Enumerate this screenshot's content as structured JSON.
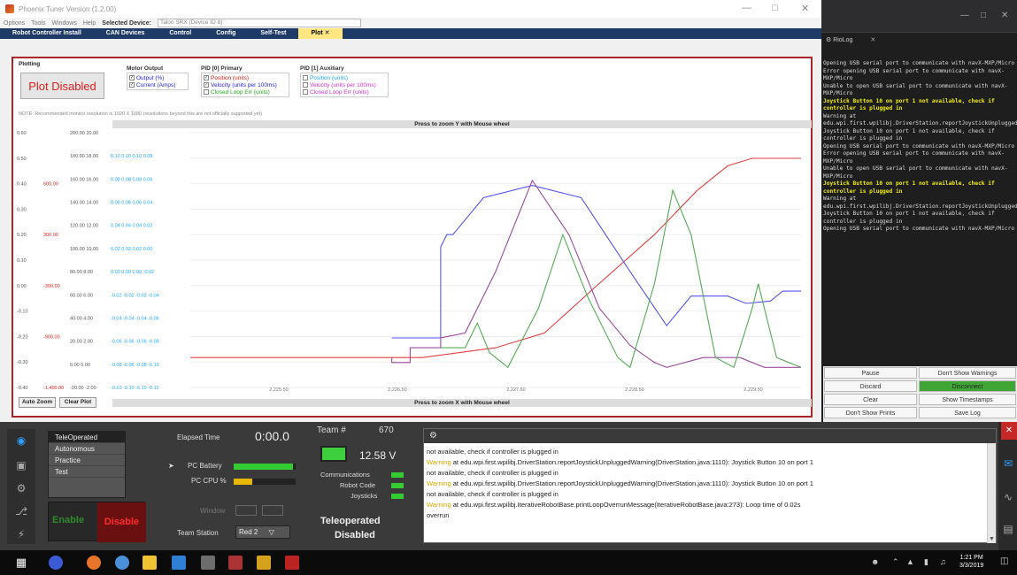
{
  "tuner": {
    "title": "Phoenix Tuner Version (1.2.00)",
    "menu": [
      "Options",
      "Tools",
      "Windows",
      "Help"
    ],
    "selected_device_label": "Selected Device:",
    "selected_device_value": "Talon SRX (Device ID 8)",
    "tabs": [
      "Robot Controller Install",
      "CAN Devices",
      "Control",
      "Config",
      "Self-Test",
      "Plot"
    ],
    "active_tab": "Plot",
    "plot": {
      "section_label": "Plotting",
      "plot_button": "Plot Disabled",
      "motor_output": {
        "title": "Motor Output",
        "items": [
          {
            "label": "Output (%)",
            "checked": true,
            "color": "#2222ee"
          },
          {
            "label": "Current (Amps)",
            "checked": true,
            "color": "#2222ee"
          }
        ]
      },
      "pid0": {
        "title": "PID [0] Primary",
        "items": [
          {
            "label": "Position (units)",
            "checked": true,
            "color": "#e02020"
          },
          {
            "label": "Velocity (units per 100ms)",
            "checked": true,
            "color": "#2222ee"
          },
          {
            "label": "Closed Loop Err (units)",
            "checked": false,
            "color": "#22aa22"
          }
        ]
      },
      "pid1": {
        "title": "PID [1] Auxiliary",
        "items": [
          {
            "label": "Position (units)",
            "checked": false,
            "color": "#22aaff"
          },
          {
            "label": "Velocity (units per 100ms)",
            "checked": false,
            "color": "#cc33cc"
          },
          {
            "label": "Closed Loop Err (units)",
            "checked": false,
            "color": "#cc33cc"
          }
        ]
      },
      "note": "NOTE: Recommended monitor resolution is 1920 X 1080 (resolutions beyond this are not officially supported yet)",
      "zoom_y": "Press to zoom Y with Mouse wheel",
      "zoom_x": "Press to zoom X with Mouse wheel",
      "auto_zoom": "Auto Zoom",
      "clear_plot": "Clear Plot"
    }
  },
  "chart_data": {
    "type": "line",
    "x_ticks": [
      "2,225.50",
      "2,226.50",
      "2,227.50",
      "2,228.50",
      "2,229.50"
    ],
    "y_axes": [
      {
        "color": "#555555",
        "labels": [
          "0.60",
          "0.50",
          "0.40",
          "0.30",
          "0.20",
          "0.10",
          "0.00",
          "-0.10",
          "-0.20",
          "-0.30",
          "-0.40"
        ]
      },
      {
        "color": "#e02020",
        "labels": [
          "",
          "",
          "600.00",
          "",
          "300.00",
          "",
          "-300.00",
          "",
          "-900.00",
          "",
          "-1,400.00"
        ]
      },
      {
        "color": "#555555",
        "labels": [
          "200.00 20.00",
          "180.00 18.00",
          "160.00 16.00",
          "140.00 14.00",
          "120.00 12.00",
          "100.00 10.00",
          "80.00 8.00",
          "60.00 6.00",
          "40.00 4.00",
          "20.00 2.00",
          "0.00 0.00",
          "-20.00 -2.00"
        ]
      },
      {
        "color": "#22aaff",
        "labels": [
          "",
          "0.10 0.10 0.10 0.08",
          "0.08 0.08 0.08 0.06",
          "0.06 0.06 0.06 0.04",
          "0.04 0.04 0.04 0.02",
          "0.02 0.02 0.02 0.00",
          "0.00 0.00 0.00 -0.02",
          "-0.02 -0.02 -0.02 -0.04",
          "-0.04 -0.04 -0.04 -0.06",
          "-0.06 -0.06 -0.06 -0.08",
          "-0.08 -0.08 -0.08 -0.10",
          "-0.10 -0.10 -0.10 -0.12"
        ]
      }
    ],
    "x_range": [
      0,
      100
    ],
    "y_range": [
      0,
      100
    ],
    "series": [
      {
        "color": "#e04040",
        "points": [
          [
            0,
            10
          ],
          [
            38,
            10
          ],
          [
            50,
            14
          ],
          [
            58,
            20
          ],
          [
            66,
            38
          ],
          [
            76,
            60
          ],
          [
            83,
            78
          ],
          [
            88,
            88
          ],
          [
            92,
            91
          ],
          [
            100,
            91
          ]
        ]
      },
      {
        "color": "#5555ee",
        "points": [
          [
            33,
            18
          ],
          [
            41,
            18
          ],
          [
            41,
            55
          ],
          [
            42,
            60
          ],
          [
            43,
            60
          ],
          [
            48,
            75
          ],
          [
            56,
            80
          ],
          [
            64,
            75
          ],
          [
            72,
            45
          ],
          [
            78,
            23
          ],
          [
            82,
            35
          ],
          [
            88,
            35
          ],
          [
            91,
            32
          ],
          [
            95,
            33
          ],
          [
            97,
            37
          ],
          [
            100,
            37
          ]
        ]
      },
      {
        "color": "#9a4a9a",
        "points": [
          [
            33,
            10
          ],
          [
            33,
            8
          ],
          [
            36,
            8
          ],
          [
            36,
            14
          ],
          [
            41,
            14
          ],
          [
            41,
            18
          ],
          [
            45,
            20
          ],
          [
            50,
            45
          ],
          [
            56,
            82
          ],
          [
            62,
            60
          ],
          [
            67,
            30
          ],
          [
            72,
            15
          ],
          [
            76,
            8
          ],
          [
            78,
            6
          ],
          [
            84,
            10
          ],
          [
            90,
            10
          ],
          [
            94,
            6
          ],
          [
            100,
            6
          ]
        ]
      },
      {
        "color": "#55aa55",
        "points": [
          [
            41,
            14
          ],
          [
            45,
            14
          ],
          [
            47,
            24
          ],
          [
            49,
            12
          ],
          [
            52,
            6
          ],
          [
            57,
            30
          ],
          [
            61,
            60
          ],
          [
            65,
            35
          ],
          [
            70,
            10
          ],
          [
            72,
            6
          ],
          [
            76,
            40
          ],
          [
            79,
            78
          ],
          [
            82,
            60
          ],
          [
            86,
            10
          ],
          [
            89,
            6
          ],
          [
            92,
            30
          ],
          [
            93,
            40
          ],
          [
            96,
            10
          ],
          [
            100,
            6
          ]
        ]
      }
    ]
  },
  "riolog": {
    "title": "RioLog",
    "lines": [
      {
        "t": "Opening USB serial port to communicate with navX-MXP/Micro",
        "y": false
      },
      {
        "t": "Error opening USB serial port to communicate with navX-MXP/Micro",
        "y": false
      },
      {
        "t": "Unable to open USB serial port to communicate with navX-MXP/Micro",
        "y": false
      },
      {
        "t": "Joystick Button 10 on port 1 not available, check if controller is plugged in",
        "y": true
      },
      {
        "t": "Warning at edu.wpi.first.wpilibj.DriverStation.reportJoystickUnpluggedWarning",
        "y": false
      },
      {
        "t": "Joystick Button 10 on port 1 not available, check if controller is plugged in",
        "y": false
      },
      {
        "t": "Opening USB serial port to communicate with navX-MXP/Micro",
        "y": false
      },
      {
        "t": "Error opening USB serial port to communicate with navX-MXP/Micro",
        "y": false
      },
      {
        "t": "Unable to open USB serial port to communicate with navX-MXP/Micro",
        "y": false
      },
      {
        "t": "Joystick Button 10 on port 1 not available, check if controller is plugged in",
        "y": true
      },
      {
        "t": "Warning at edu.wpi.first.wpilibj.DriverStation.reportJoystickUnpluggedWarning",
        "y": false
      },
      {
        "t": "Joystick Button 10 on port 1 not available, check if controller is plugged in",
        "y": false
      },
      {
        "t": "Opening USB serial port to communicate with navX-MXP/Micro",
        "y": false
      }
    ],
    "buttons": {
      "pause": "Pause",
      "dont_show_warnings": "Don't Show Warnings",
      "discard": "Discard",
      "disconnect": "Disconnect",
      "clear": "Clear",
      "show_timestamps": "Show Timestamps",
      "dont_show_prints": "Don't Show Prints",
      "save_log": "Save Log"
    }
  },
  "ds": {
    "modes": [
      "TeleOperated",
      "Autonomous",
      "Practice",
      "Test"
    ],
    "selected_mode": "TeleOperated",
    "enable": "Enable",
    "disable": "Disable",
    "elapsed_label": "Elapsed Time",
    "elapsed_value": "0:00.0",
    "pc_battery_label": "PC Battery",
    "pc_cpu_label": "PC CPU %",
    "window_label": "Window",
    "team_station_label": "Team Station",
    "team_station_value": "Red 2",
    "team_label": "Team #",
    "team_number": "670",
    "voltage": "12.58 V",
    "communications": "Communications",
    "robot_code": "Robot Code",
    "joysticks": "Joysticks",
    "status1": "Teleoperated",
    "status2": "Disabled",
    "messages": [
      {
        "w": "",
        "t": "not available, check if controller is plugged in"
      },
      {
        "w": "Warning",
        "t": " at edu.wpi.first.wpilibj.DriverStation.reportJoystickUnpluggedWarning(DriverStation.java:1110): Joystick Button 10 on port 1"
      },
      {
        "w": "",
        "t": "not available, check if controller is plugged in"
      },
      {
        "w": "Warning",
        "t": " at edu.wpi.first.wpilibj.DriverStation.reportJoystickUnpluggedWarning(DriverStation.java:1110): Joystick Button 10 on port 1"
      },
      {
        "w": "",
        "t": "not available, check if controller is plugged in"
      },
      {
        "w": "Warning",
        "t": " at edu.wpi.first.wpilibj.IterativeRobotBase.printLoopOverrunMessage(IterativeRobotBase.java:273): Loop time of 0.02s"
      },
      {
        "w": "",
        "t": "overrun"
      }
    ]
  },
  "taskbar": {
    "time": "1:21 PM",
    "date": "3/3/2019"
  }
}
